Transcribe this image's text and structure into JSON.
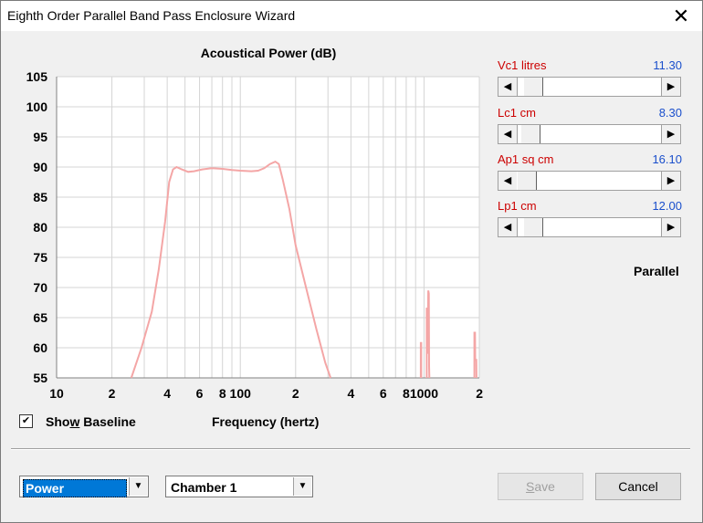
{
  "window": {
    "title": "Eighth Order Parallel Band Pass Enclosure Wizard",
    "close_glyph": "✕"
  },
  "chart_data": {
    "type": "line",
    "title": "Acoustical Power (dB)",
    "xlabel": "Frequency (hertz)",
    "ylabel": "",
    "xscale": "log",
    "xlim": [
      10,
      2000
    ],
    "ylim": [
      55,
      105
    ],
    "yticks": [
      105,
      100,
      95,
      90,
      85,
      80,
      75,
      70,
      65,
      60,
      55
    ],
    "xtick_labels": [
      {
        "x": 10,
        "label": "10"
      },
      {
        "x": 20,
        "label": "2"
      },
      {
        "x": 40,
        "label": "4"
      },
      {
        "x": 60,
        "label": "6"
      },
      {
        "x": 80,
        "label": "8"
      },
      {
        "x": 100,
        "label": "100"
      },
      {
        "x": 200,
        "label": "2"
      },
      {
        "x": 400,
        "label": "4"
      },
      {
        "x": 600,
        "label": "6"
      },
      {
        "x": 800,
        "label": "8"
      },
      {
        "x": 1000,
        "label": "1000"
      },
      {
        "x": 2000,
        "label": "2"
      }
    ],
    "grid": true,
    "line_color": "#f4a6a6",
    "series": [
      {
        "name": "",
        "points": [
          [
            25.5,
            55
          ],
          [
            29,
            60
          ],
          [
            33,
            66
          ],
          [
            36,
            73
          ],
          [
            39,
            81
          ],
          [
            41,
            87.5
          ],
          [
            43,
            89.6
          ],
          [
            45,
            90
          ],
          [
            48,
            89.6
          ],
          [
            52,
            89.2
          ],
          [
            56,
            89.3
          ],
          [
            62,
            89.6
          ],
          [
            70,
            89.8
          ],
          [
            80,
            89.7
          ],
          [
            90,
            89.5
          ],
          [
            100,
            89.4
          ],
          [
            115,
            89.3
          ],
          [
            125,
            89.4
          ],
          [
            135,
            89.8
          ],
          [
            145,
            90.5
          ],
          [
            155,
            90.9
          ],
          [
            162,
            90.5
          ],
          [
            170,
            88
          ],
          [
            185,
            83
          ],
          [
            200,
            77
          ],
          [
            230,
            69.5
          ],
          [
            260,
            63
          ],
          [
            290,
            57.5
          ],
          [
            310,
            55
          ]
        ]
      },
      {
        "name": "",
        "points": [
          [
            960,
            55
          ],
          [
            960,
            60.8
          ],
          [
            966,
            60.8
          ],
          [
            966,
            55
          ]
        ]
      },
      {
        "name": "",
        "points": [
          [
            1035,
            55
          ],
          [
            1035,
            66.5
          ],
          [
            1045,
            66.5
          ],
          [
            1045,
            59
          ],
          [
            1055,
            69.5
          ],
          [
            1062,
            69
          ],
          [
            1066,
            57
          ],
          [
            1070,
            55
          ]
        ]
      },
      {
        "name": "",
        "points": [
          [
            1880,
            55
          ],
          [
            1880,
            62.5
          ],
          [
            1895,
            62.5
          ],
          [
            1900,
            58
          ],
          [
            1925,
            58
          ],
          [
            1930,
            55
          ]
        ]
      }
    ]
  },
  "params": [
    {
      "label": "Vc1  litres",
      "value": "11.30",
      "level": 0.05
    },
    {
      "label": "Lc1  cm",
      "value": "8.30",
      "level": 0.03
    },
    {
      "label": "Ap1  sq cm",
      "value": "16.10",
      "level": 0.0
    },
    {
      "label": "Lp1  cm",
      "value": "12.00",
      "level": 0.05
    }
  ],
  "scroll_left_glyph": "◀",
  "scroll_right_glyph": "▶",
  "mode_text": "Parallel",
  "show_baseline": {
    "checked_glyph": "✔",
    "label": "Show Baseline"
  },
  "combo_mode": {
    "value": "Power",
    "drop_glyph": "▼"
  },
  "combo_chamber": {
    "value": "Chamber 1",
    "drop_glyph": "▼"
  },
  "buttons": {
    "save": "Save",
    "cancel": "Cancel"
  },
  "colors": {
    "param_label": "#cc0000",
    "param_value": "#1a4fcc",
    "selection": "#0078d7"
  }
}
